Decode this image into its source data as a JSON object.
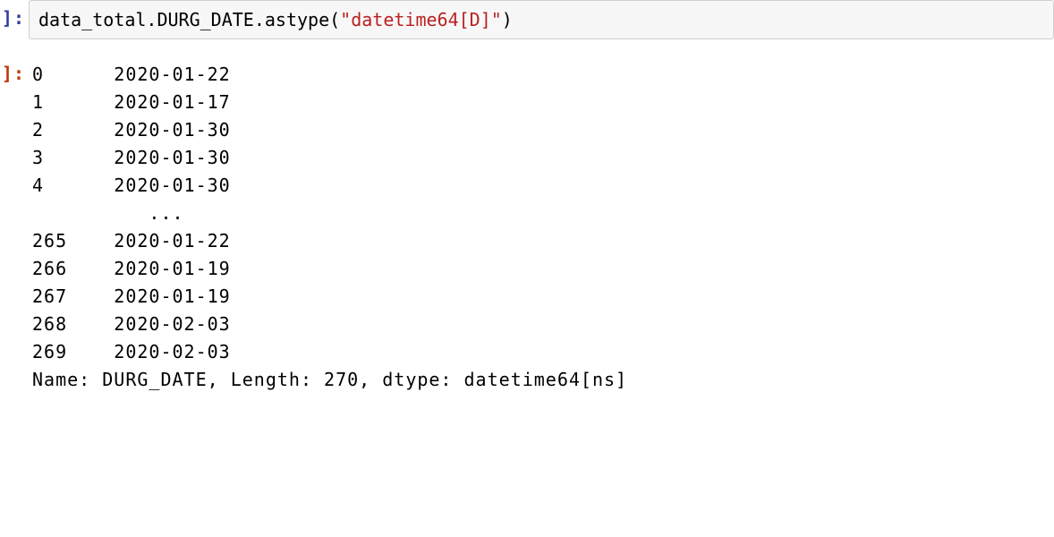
{
  "input_cell": {
    "prompt": "]:",
    "code_prefix": "data_total.DURG_DATE.astype(",
    "code_quote": "\"",
    "code_string": "datetime64[D]",
    "code_suffix": ")"
  },
  "output_cell": {
    "prompt": "]:",
    "rows": [
      {
        "index": "0",
        "value": "2020-01-22"
      },
      {
        "index": "1",
        "value": "2020-01-17"
      },
      {
        "index": "2",
        "value": "2020-01-30"
      },
      {
        "index": "3",
        "value": "2020-01-30"
      },
      {
        "index": "4",
        "value": "2020-01-30"
      },
      {
        "index": "",
        "value": "...    "
      },
      {
        "index": "265",
        "value": "2020-01-22"
      },
      {
        "index": "266",
        "value": "2020-01-19"
      },
      {
        "index": "267",
        "value": "2020-01-19"
      },
      {
        "index": "268",
        "value": "2020-02-03"
      },
      {
        "index": "269",
        "value": "2020-02-03"
      }
    ],
    "footer": "Name: DURG_DATE, Length: 270, dtype: datetime64[ns]"
  }
}
